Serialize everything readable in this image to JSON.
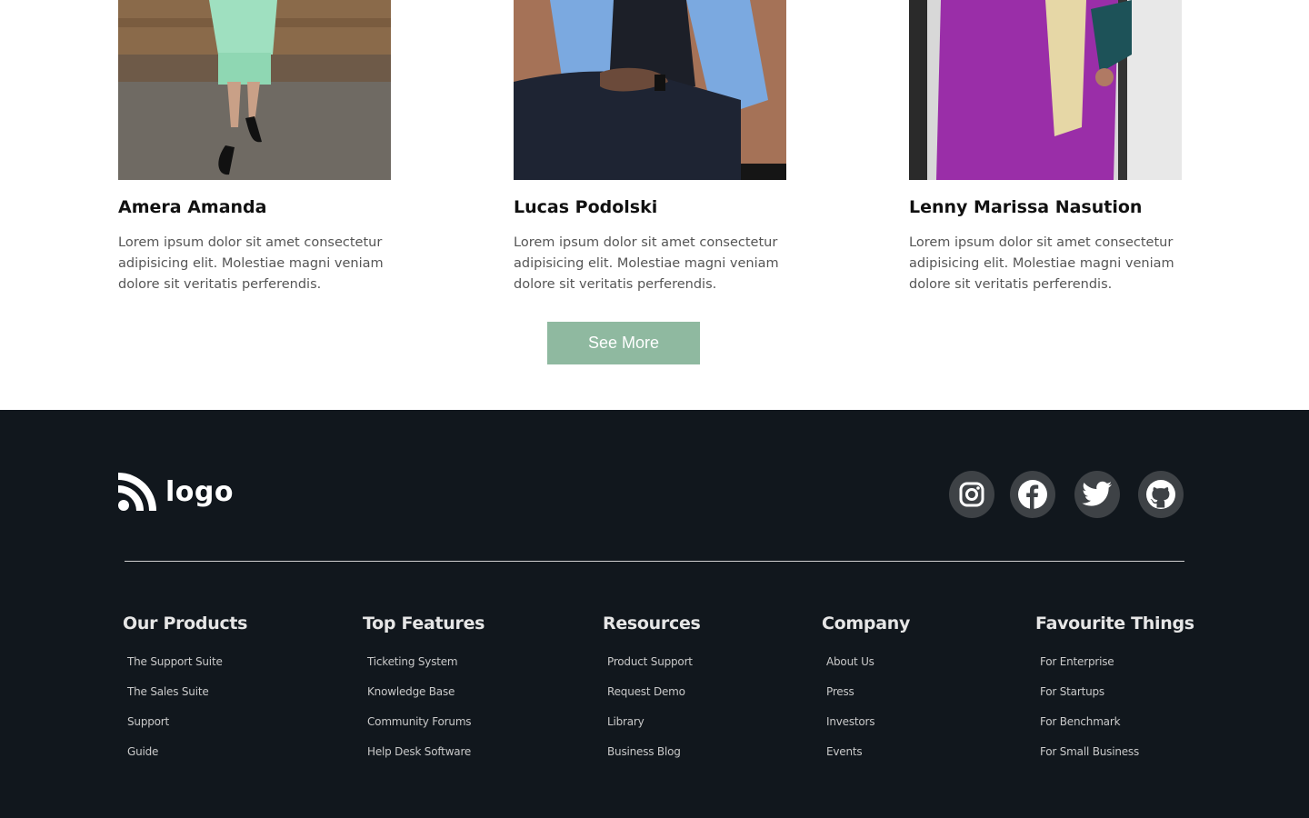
{
  "team": [
    {
      "name": "Amera Amanda",
      "bio": "Lorem ipsum dolor sit amet consectetur adipisicing elit. Molestiae magni veniam dolore sit veritatis perferendis."
    },
    {
      "name": "Lucas Podolski",
      "bio": "Lorem ipsum dolor sit amet consectetur adipisicing elit. Molestiae magni veniam dolore sit veritatis perferendis."
    },
    {
      "name": "Lenny Marissa Nasution",
      "bio": "Lorem ipsum dolor sit amet consectetur adipisicing elit. Molestiae magni veniam dolore sit veritatis perferendis."
    }
  ],
  "see_more_label": "See More",
  "footer": {
    "logo_text": "logo",
    "socials": [
      "instagram-icon",
      "facebook-icon",
      "twitter-icon",
      "github-icon"
    ],
    "columns": [
      {
        "title": "Our Products",
        "links": [
          "The Support Suite",
          "The Sales Suite",
          "Support",
          "Guide"
        ]
      },
      {
        "title": "Top Features",
        "links": [
          "Ticketing System",
          "Knowledge Base",
          "Community Forums",
          "Help Desk Software"
        ]
      },
      {
        "title": "Resources",
        "links": [
          "Product Support",
          "Request Demo",
          "Library",
          "Business Blog"
        ]
      },
      {
        "title": "Company",
        "links": [
          "About Us",
          "Press",
          "Investors",
          "Events"
        ]
      },
      {
        "title": "Favourite Things",
        "links": [
          "For Enterprise",
          "For Startups",
          "For Benchmark",
          "For Small Business"
        ]
      }
    ]
  },
  "colors": {
    "button": "#8fb9a0",
    "footer_bg": "#11171d",
    "social_bg": "#3e4246"
  }
}
